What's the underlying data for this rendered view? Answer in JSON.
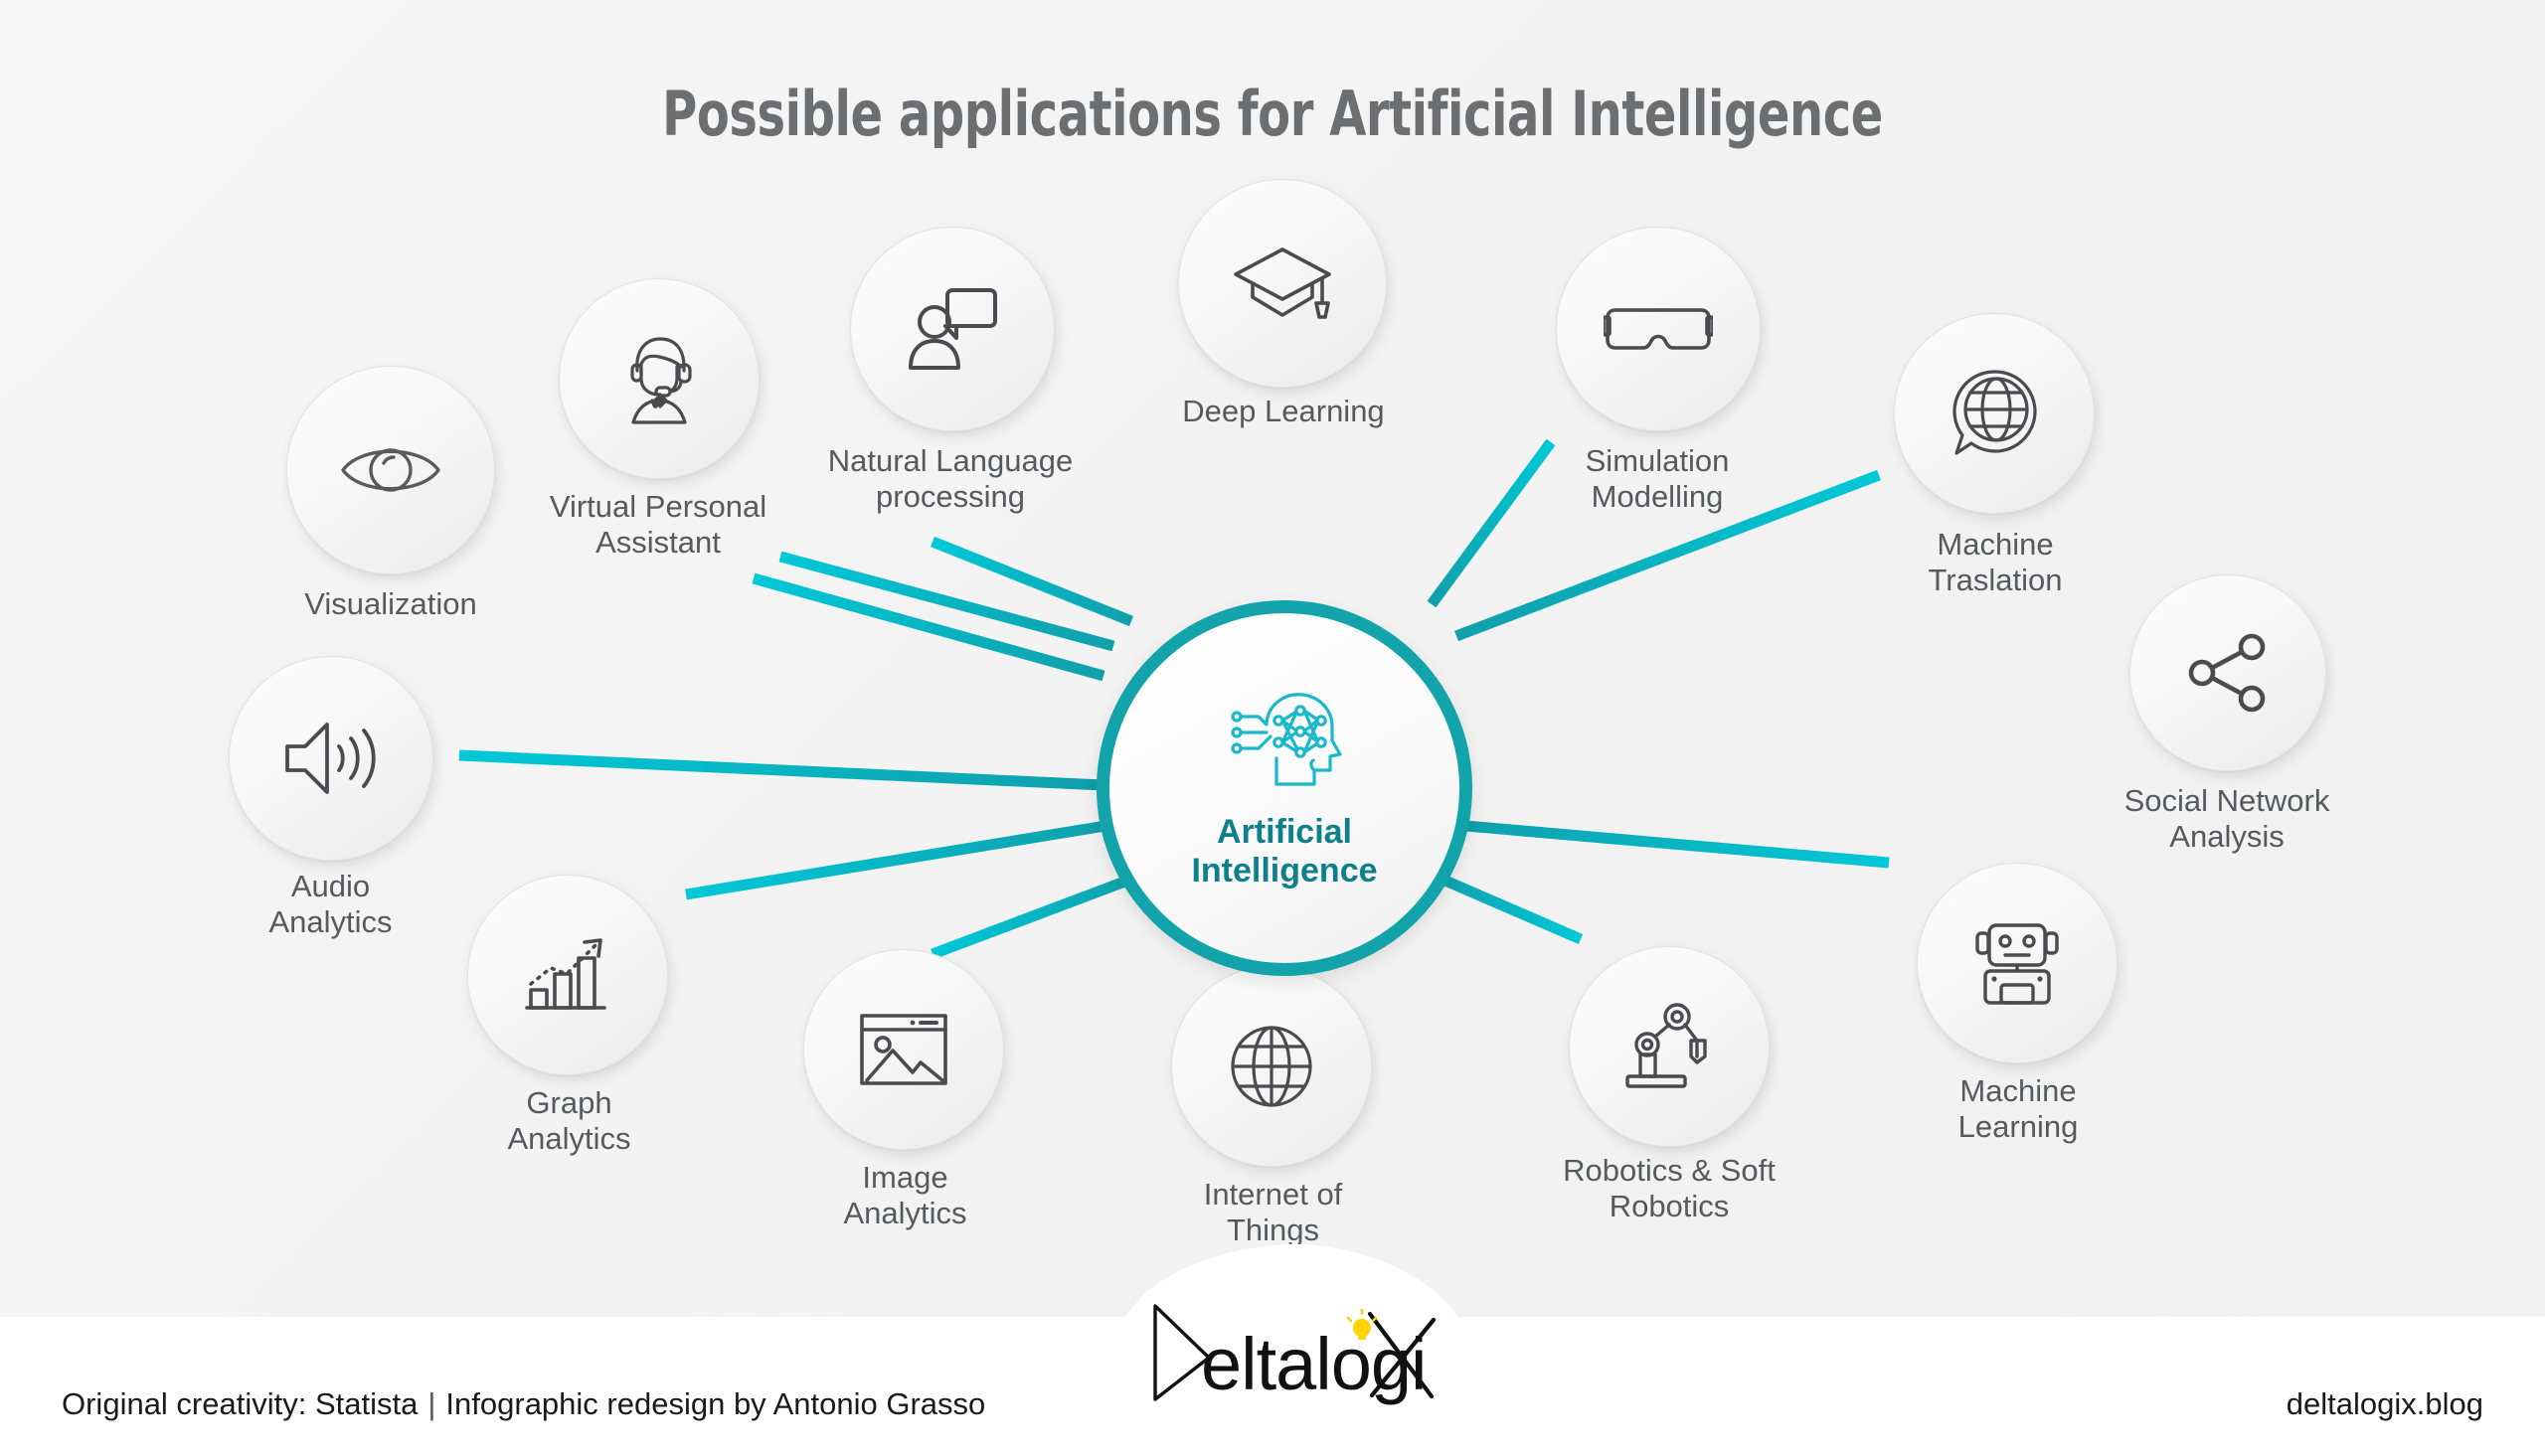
{
  "title": "Possible applications for Artificial Intelligence",
  "hub": {
    "label": "Artificial\nIntelligence",
    "icon": "ai-head-network-icon",
    "ring_color": "#13a3ab",
    "text_color": "#0e7f8c"
  },
  "colors": {
    "background": "#f4f4f4",
    "footer_background": "#ffffff",
    "title_text": "#6d6e70",
    "node_text": "#58595b",
    "node_icon": "#5a5a5c",
    "connector_inner": "#10a0ab",
    "connector_outer": "#00c8d8",
    "logo_bulb": "#ffd400"
  },
  "nodes": [
    {
      "id": "visualization",
      "label": "Visualization",
      "icon": "eye-icon"
    },
    {
      "id": "virtual-assistant",
      "label": "Virtual Personal\nAssistant",
      "icon": "headset-agent-icon"
    },
    {
      "id": "nlp",
      "label": "Natural Language\nprocessing",
      "icon": "person-speech-bubble-icon"
    },
    {
      "id": "deep-learning",
      "label": "Deep Learning",
      "icon": "graduation-cap-icon"
    },
    {
      "id": "simulation-modelling",
      "label": "Simulation\nModelling",
      "icon": "vr-goggles-icon"
    },
    {
      "id": "machine-translation",
      "label": "Machine\nTraslation",
      "icon": "globe-speech-bubble-icon"
    },
    {
      "id": "social-network",
      "label": "Social Network\nAnalysis",
      "icon": "share-nodes-icon"
    },
    {
      "id": "machine-learning",
      "label": "Machine\nLearning",
      "icon": "robot-head-icon"
    },
    {
      "id": "robotics",
      "label": "Robotics & Soft\nRobotics",
      "icon": "robot-arm-icon"
    },
    {
      "id": "internet-of-things",
      "label": "Internet of\nThings",
      "icon": "globe-grid-icon"
    },
    {
      "id": "image-analytics",
      "label": "Image\nAnalytics",
      "icon": "picture-icon"
    },
    {
      "id": "graph-analytics",
      "label": "Graph\nAnalytics",
      "icon": "bar-chart-arrow-icon"
    },
    {
      "id": "audio-analytics",
      "label": "Audio\nAnalytics",
      "icon": "speaker-waves-icon"
    }
  ],
  "footer": {
    "credit_left": "Original creativity: Statista",
    "credit_separator": "|",
    "credit_right": "Infographic redesign by Antonio Grasso",
    "url": "deltalogix.blog",
    "logo_text": "Deltalogix"
  }
}
